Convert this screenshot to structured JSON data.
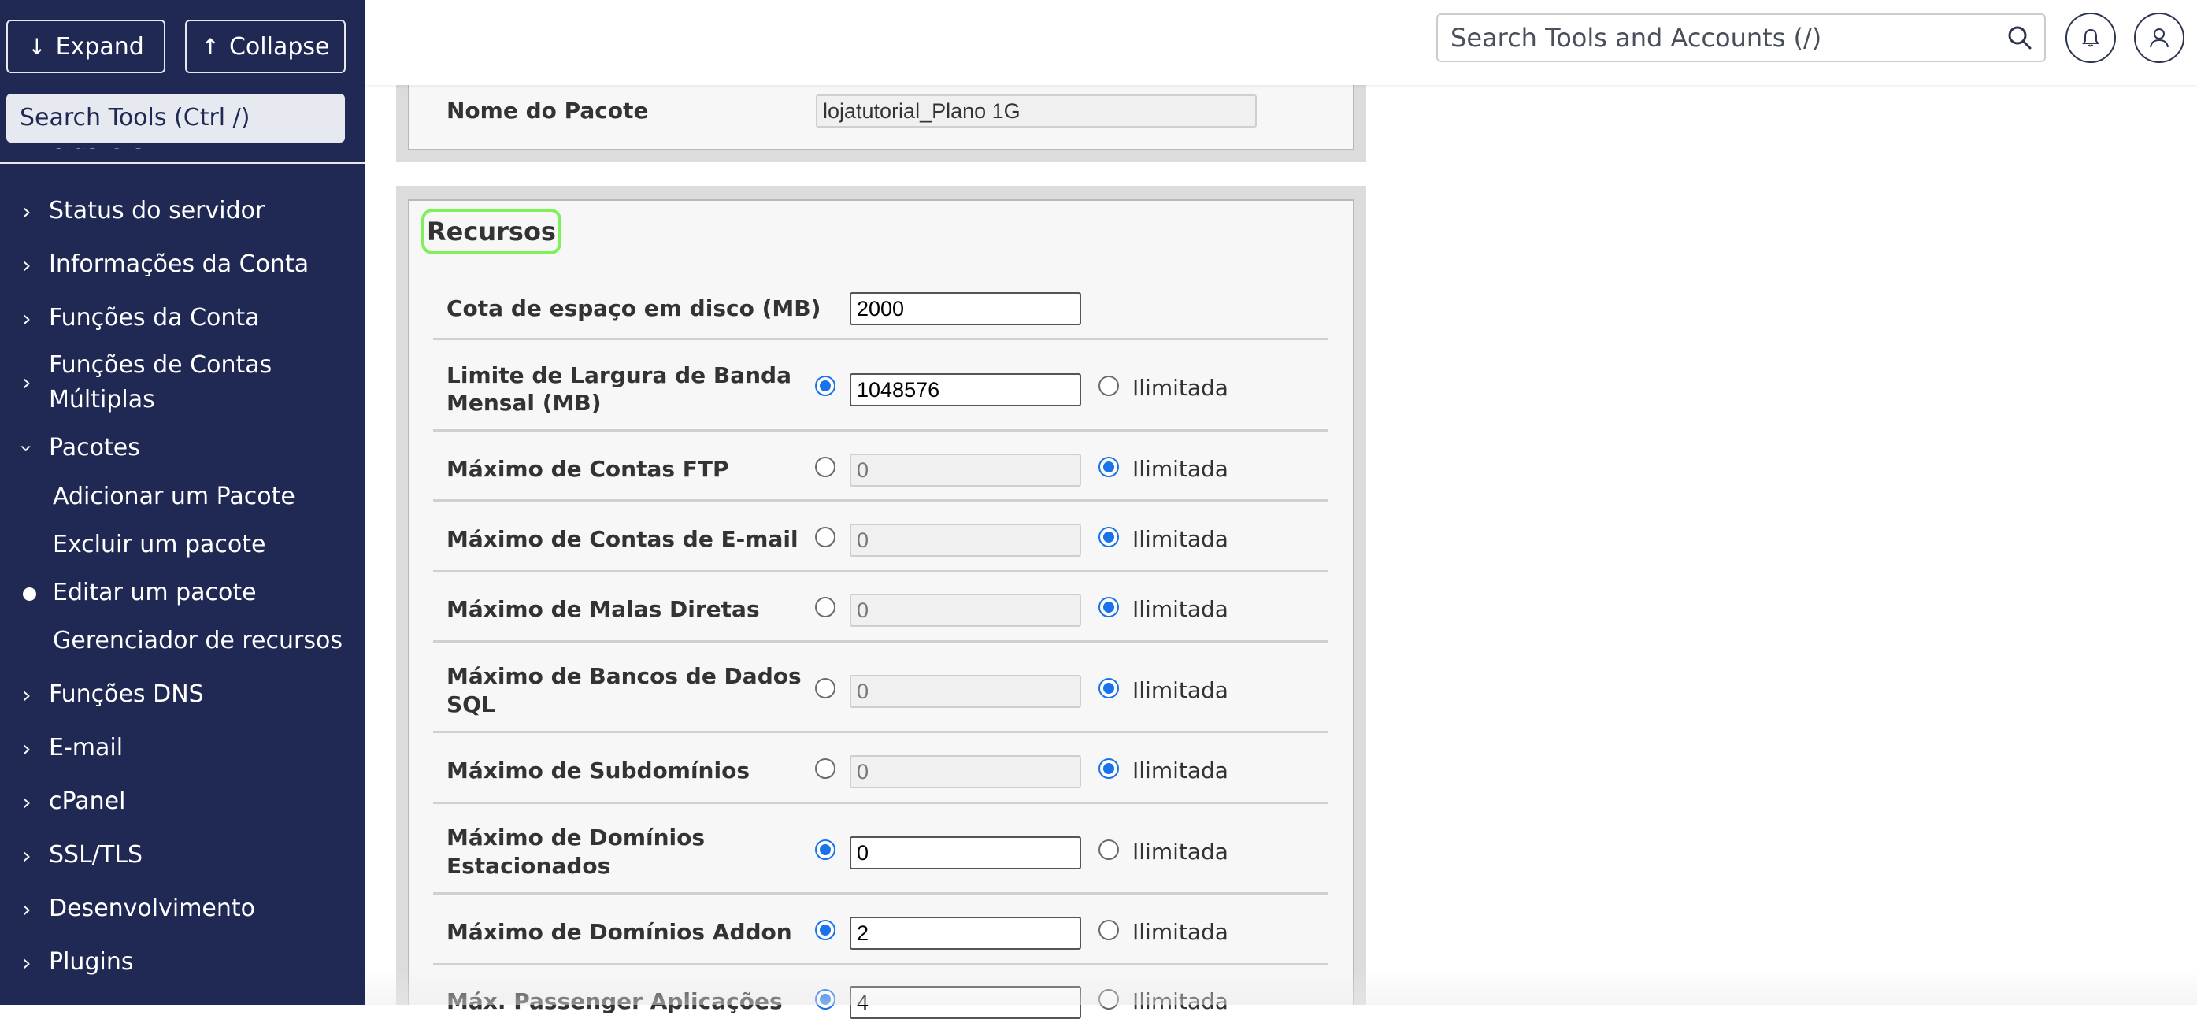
{
  "sidebar": {
    "expand_label": "Expand",
    "collapse_label": "Collapse",
    "search_placeholder": "Search Tools (Ctrl /)",
    "clipped_item": "Clusters",
    "items": [
      {
        "label": "Status do servidor"
      },
      {
        "label": "Informações da Conta"
      },
      {
        "label": "Funções da Conta"
      },
      {
        "label_line1": "Funções de Contas",
        "label_line2": "Múltiplas"
      },
      {
        "label": "Pacotes"
      },
      {
        "label": "Funções DNS"
      },
      {
        "label": "E-mail"
      },
      {
        "label": "cPanel"
      },
      {
        "label": "SSL/TLS"
      },
      {
        "label": "Desenvolvimento"
      },
      {
        "label": "Plugins"
      }
    ],
    "pacotes_sub": [
      {
        "label": "Adicionar um Pacote"
      },
      {
        "label": "Excluir um pacote"
      },
      {
        "label": "Editar um pacote",
        "active": true
      },
      {
        "label": "Gerenciador de recursos"
      }
    ]
  },
  "header": {
    "search_placeholder": "Search Tools and Accounts (/)",
    "icons": [
      "search-icon",
      "bell-icon",
      "user-icon"
    ]
  },
  "package": {
    "name_label": "Nome do Pacote",
    "name_value": "lojatutorial_Plano 1G"
  },
  "resources": {
    "title": "Recursos",
    "unlimited_label": "Ilimitada",
    "disk": {
      "label": "Cota de espaço em disco (MB)",
      "value": "2000"
    },
    "rows": [
      {
        "label_line1": "Limite de Largura de Banda",
        "label_line2": "Mensal (MB)",
        "value": "1048576",
        "unlimited": false
      },
      {
        "label_line1": "Máximo de Contas FTP",
        "label_line2": "",
        "value": "0",
        "unlimited": true
      },
      {
        "label_line1": "Máximo de Contas de E-mail",
        "label_line2": "",
        "value": "0",
        "unlimited": true
      },
      {
        "label_line1": "Máximo de Malas Diretas",
        "label_line2": "",
        "value": "0",
        "unlimited": true
      },
      {
        "label_line1": "Máximo de Bancos de Dados",
        "label_line2": "SQL",
        "value": "0",
        "unlimited": true
      },
      {
        "label_line1": "Máximo de Subdomínios",
        "label_line2": "",
        "value": "0",
        "unlimited": true
      },
      {
        "label_line1": "Máximo de Domínios",
        "label_line2": "Estacionados",
        "value": "0",
        "unlimited": false
      },
      {
        "label_line1": "Máximo de Domínios Addon",
        "label_line2": "",
        "value": "2",
        "unlimited": false
      },
      {
        "label_line1": "Máx. Passenger Aplicações",
        "label_line2": "",
        "value": "4",
        "unlimited": false
      }
    ]
  },
  "colors": {
    "sidebar_bg": "#1f2954",
    "radio_accent": "#1a73e8",
    "highlight_outline": "#7ef05a"
  }
}
